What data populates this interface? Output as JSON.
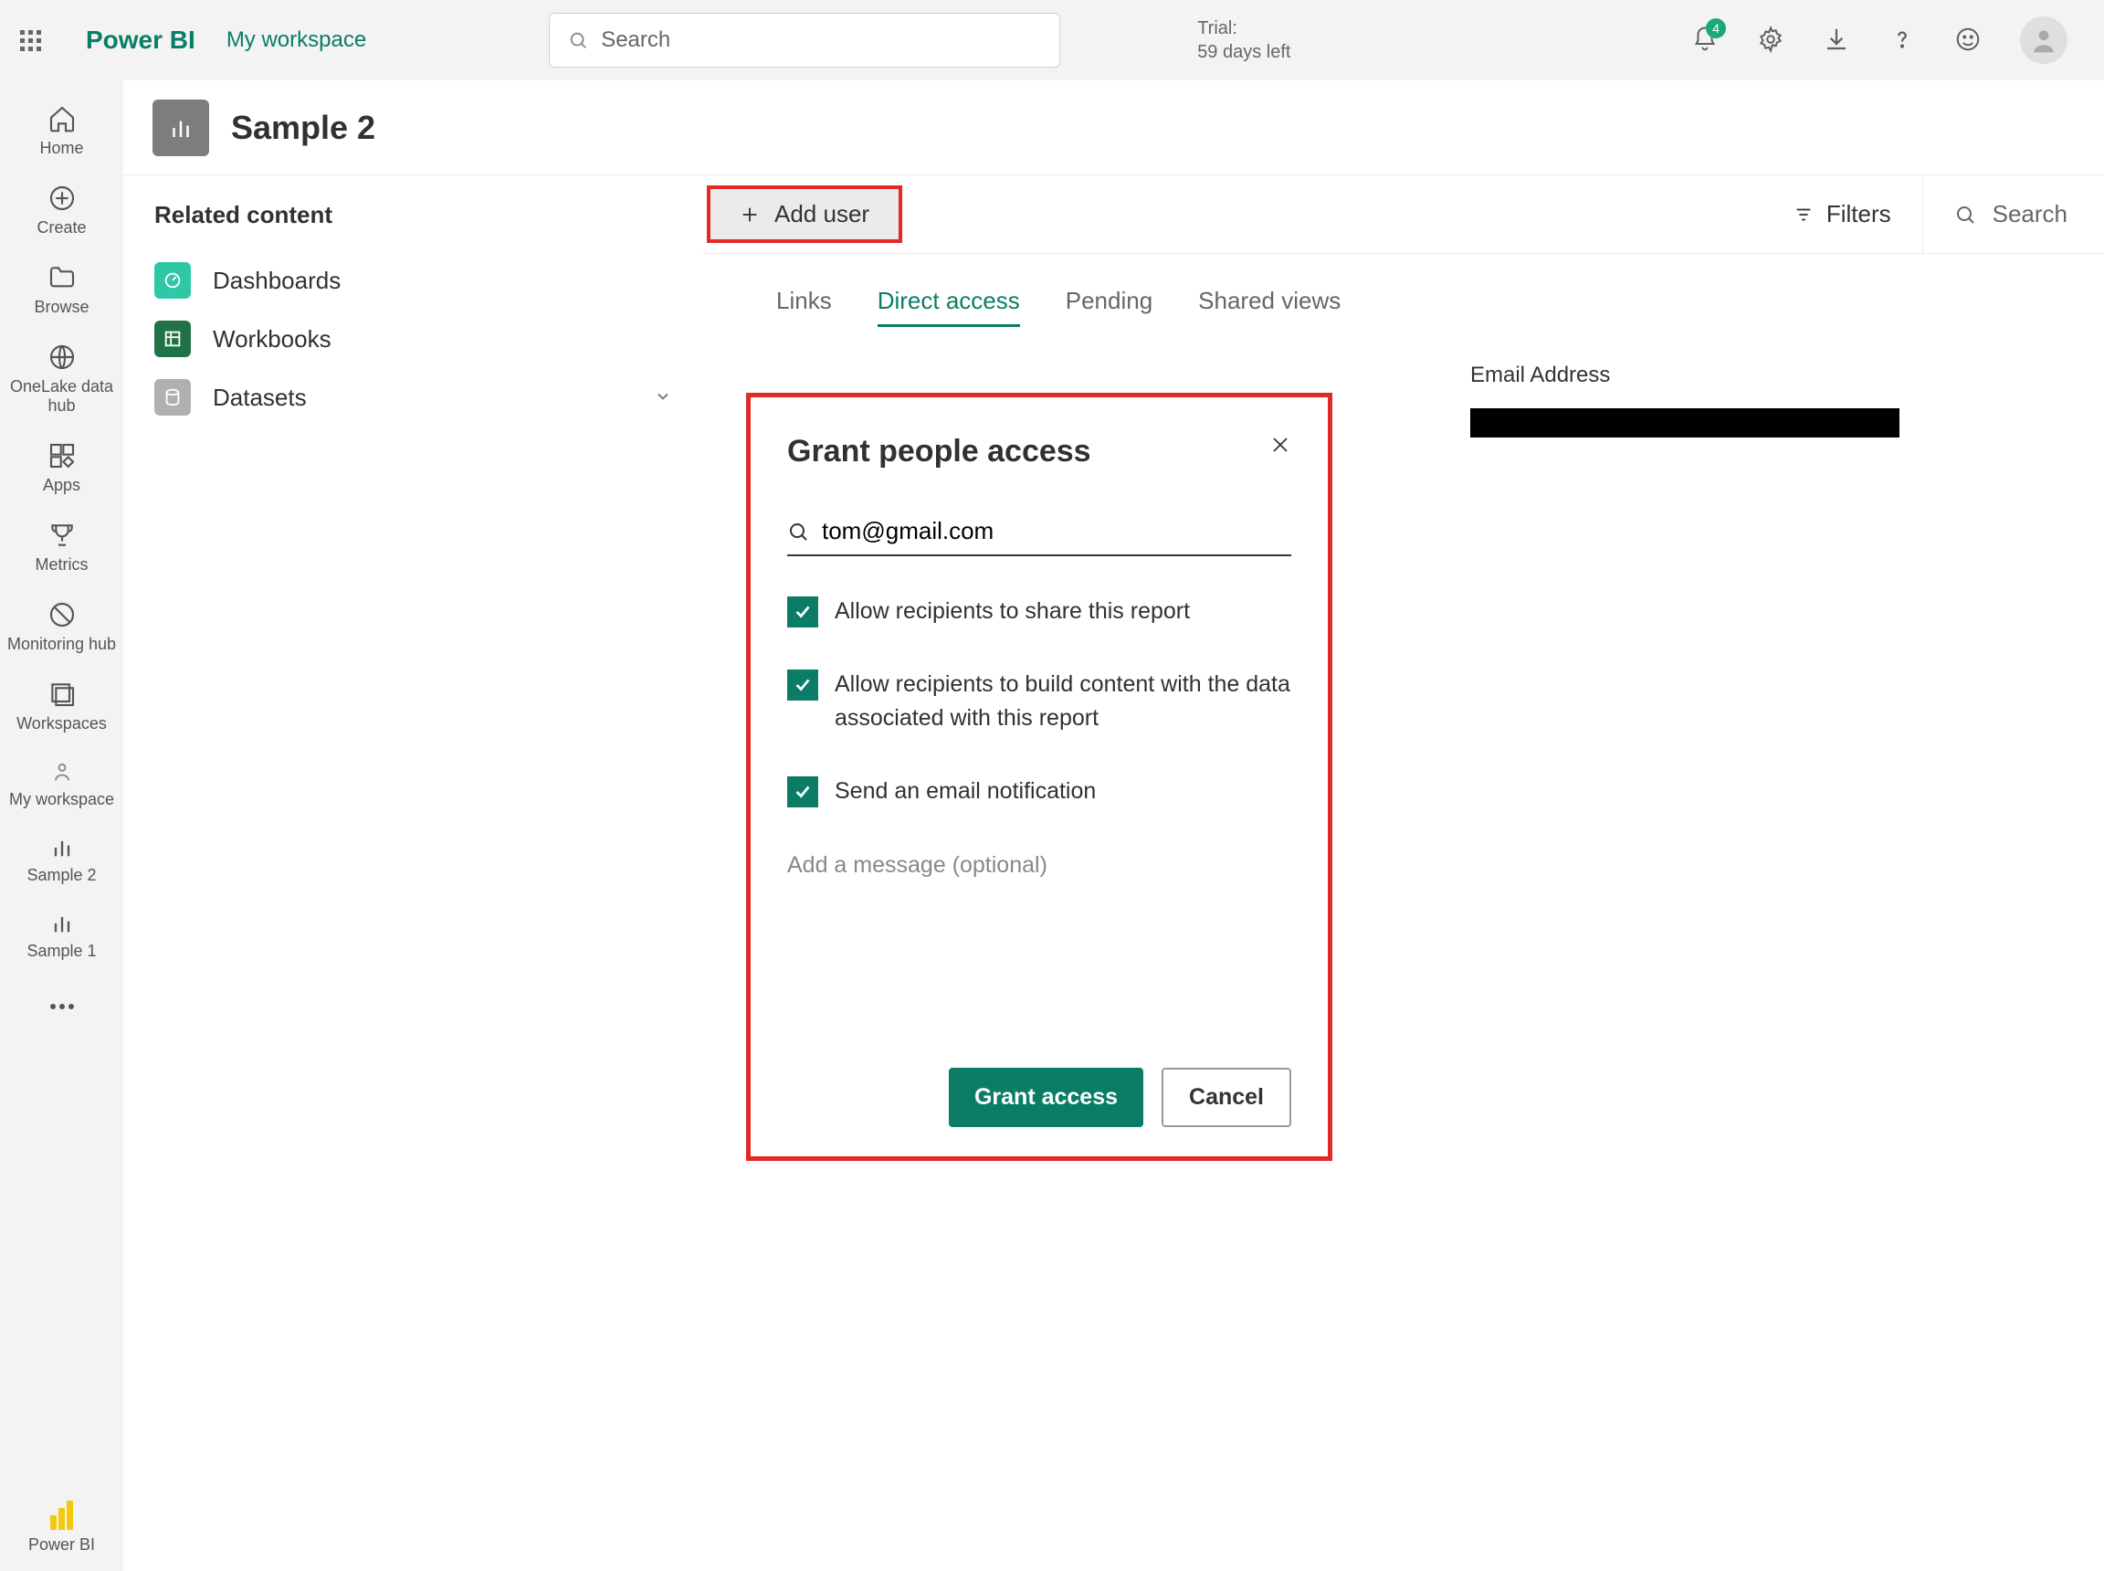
{
  "header": {
    "brand": "Power BI",
    "workspace": "My workspace",
    "search_placeholder": "Search",
    "trial_line1": "Trial:",
    "trial_line2": "59 days left",
    "notif_count": "4"
  },
  "rail": {
    "home": "Home",
    "create": "Create",
    "browse": "Browse",
    "onelake": "OneLake data hub",
    "apps": "Apps",
    "metrics": "Metrics",
    "monitoring": "Monitoring hub",
    "workspaces": "Workspaces",
    "my_workspace": "My workspace",
    "sample2": "Sample 2",
    "sample1": "Sample 1",
    "footer": "Power BI"
  },
  "page": {
    "title": "Sample 2",
    "related_heading": "Related content",
    "items": {
      "dashboards": "Dashboards",
      "workbooks": "Workbooks",
      "datasets": "Datasets"
    }
  },
  "perm": {
    "add_user": "Add user",
    "filters": "Filters",
    "search": "Search",
    "tabs": {
      "links": "Links",
      "direct": "Direct access",
      "pending": "Pending",
      "shared": "Shared views"
    },
    "col_email": "Email Address"
  },
  "dialog": {
    "title": "Grant people access",
    "email_value": "tom@gmail.com",
    "opt_share": "Allow recipients to share this report",
    "opt_build": "Allow recipients to build content with the data associated with this report",
    "opt_notify": "Send an email notification",
    "msg_placeholder": "Add a message (optional)",
    "grant": "Grant access",
    "cancel": "Cancel"
  }
}
